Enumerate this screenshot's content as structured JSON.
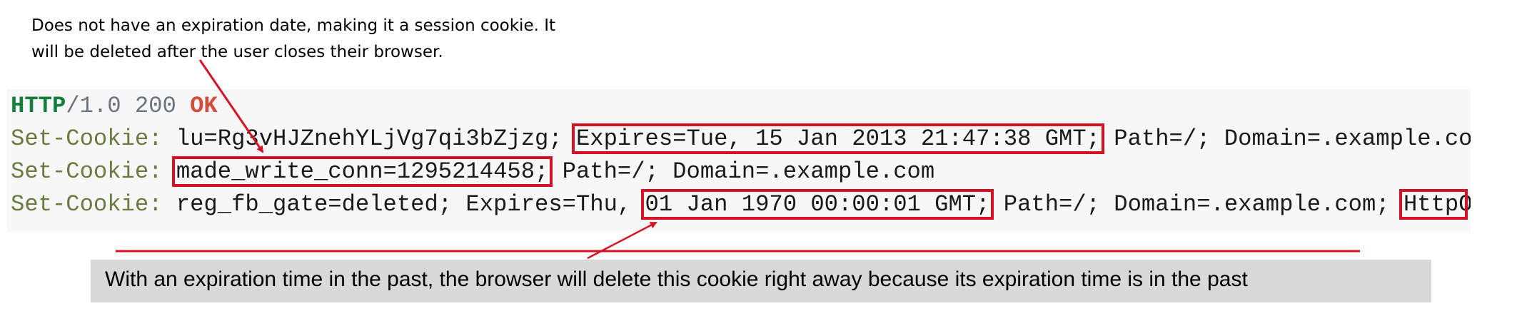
{
  "annotations": {
    "session_note_line1": "Does not have an expiration date, making it a session cookie. It",
    "session_note_line2": "will be deleted after the user closes their browser.",
    "past_expiry_note": "With an expiration time in the past, the browser will delete this cookie right away because its expiration time is in the past"
  },
  "http_response": {
    "status": {
      "protocol": "HTTP",
      "version_code": "/1.0 200 ",
      "reason": "OK"
    },
    "cookie_lines": [
      {
        "header": "Set-Cookie:",
        "pre": " lu=Rg3vHJZnehYLjVg7qi3bZjzg; ",
        "highlight": "Expires=Tue, 15 Jan 2013 21:47:38 GMT;",
        "post": " Path=/; Domain=.example.com; HttpOnly"
      },
      {
        "header": "Set-Cookie:",
        "pre": " ",
        "highlight": "made_write_conn=1295214458;",
        "post": " Path=/; Domain=.example.com"
      },
      {
        "header": "Set-Cookie:",
        "pre": " reg_fb_gate=deleted; Expires=Thu, ",
        "highlight": "01 Jan 1970 00:00:01 GMT;",
        "mid": " Path=/; Domain=.example.com; ",
        "highlight2": "HttpOnly"
      }
    ]
  },
  "colors": {
    "highlight_border": "#d41223",
    "arrow": "#d41223",
    "code_background": "#f7f7f7",
    "banner_background": "#d9d9d9",
    "header_name": "#6b7a3f",
    "protocol": "#15803d",
    "ok_status": "#d44c3a"
  }
}
